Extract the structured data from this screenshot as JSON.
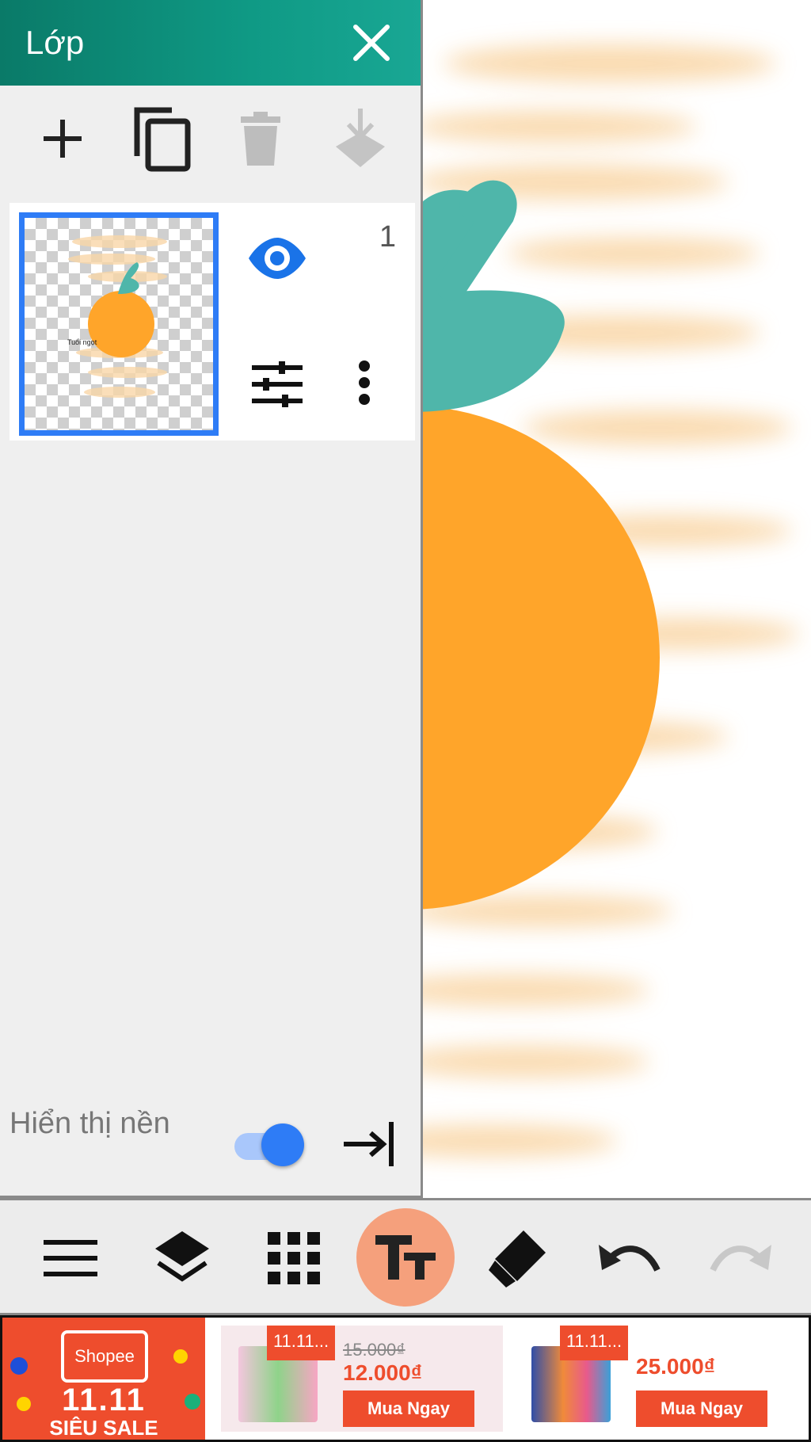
{
  "panel": {
    "title": "Lớp",
    "close_icon": "close-icon",
    "tools": [
      "add-layer-icon",
      "duplicate-layer-icon",
      "delete-layer-icon",
      "merge-down-icon"
    ],
    "layer": {
      "number": "1",
      "thumbnail_text": "Tuổi ngọt",
      "icons": [
        "eye-icon",
        "adjust-icon",
        "more-vert-icon"
      ]
    },
    "background_label": "Hiển thị nền",
    "background_visible": true
  },
  "toolbar": {
    "items": [
      "menu-icon",
      "layers-icon",
      "grid-icon",
      "text-icon",
      "eraser-icon",
      "undo-icon",
      "redo-icon"
    ],
    "active": "text-icon",
    "active_color": "#f5a07c"
  },
  "ad": {
    "brand": {
      "logo_text": "Shopee",
      "event": "11.11",
      "label": "SIÊU SALE"
    },
    "products": [
      {
        "tag": "11.11...",
        "old_price": "15.000₫",
        "price": "12.000₫",
        "button": "Mua Ngay"
      },
      {
        "tag": "11.11...",
        "old_price": "",
        "price": "25.000₫",
        "button": "Mua Ngay"
      }
    ]
  },
  "colors": {
    "accent": "#2e7cf6",
    "header": "#0f9a85",
    "shopee": "#ee4d2d",
    "orange": "#ffa52a",
    "leaf": "#4fb6aa"
  }
}
